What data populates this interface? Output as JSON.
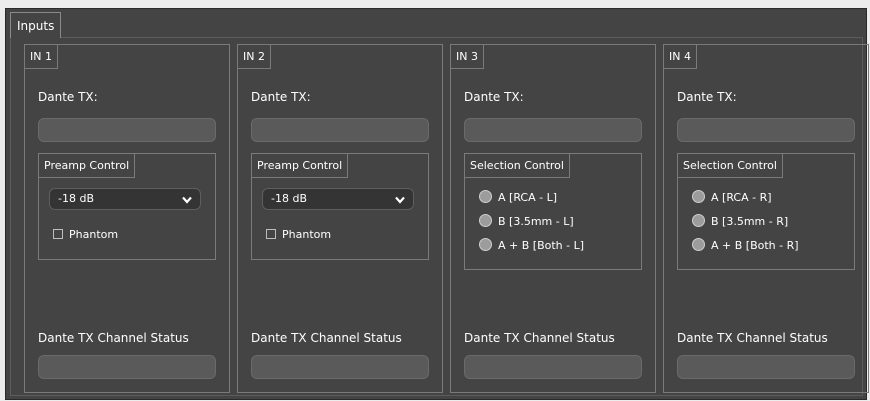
{
  "inputs_group": {
    "label": "Inputs"
  },
  "panels": [
    {
      "title": "IN 1",
      "dante_tx_label": "Dante TX:",
      "control": {
        "label": "Preamp Control",
        "selected": "-18 dB",
        "phantom_label": "Phantom",
        "phantom_checked": false
      },
      "status_label": "Dante TX Channel Status"
    },
    {
      "title": "IN 2",
      "dante_tx_label": "Dante TX:",
      "control": {
        "label": "Preamp Control",
        "selected": "-18 dB",
        "phantom_label": "Phantom",
        "phantom_checked": false
      },
      "status_label": "Dante TX Channel Status"
    },
    {
      "title": "IN 3",
      "dante_tx_label": "Dante TX:",
      "control": {
        "label": "Selection Control",
        "options": [
          "A [RCA - L]",
          "B [3.5mm - L]",
          "A + B [Both - L]"
        ]
      },
      "status_label": "Dante TX Channel Status"
    },
    {
      "title": "IN 4",
      "dante_tx_label": "Dante TX:",
      "control": {
        "label": "Selection Control",
        "options": [
          "A [RCA - R]",
          "B [3.5mm - R]",
          "A + B [Both - R]"
        ]
      },
      "status_label": "Dante TX Channel Status"
    }
  ],
  "icons": {
    "dropdown": "chevron-down-icon",
    "radio": "radio-button-icon",
    "checkbox": "checkbox-icon"
  },
  "colors": {
    "background": "#444444",
    "field": "#5a5a5a",
    "border": "#7a7a7a",
    "text": "#ffffff"
  }
}
